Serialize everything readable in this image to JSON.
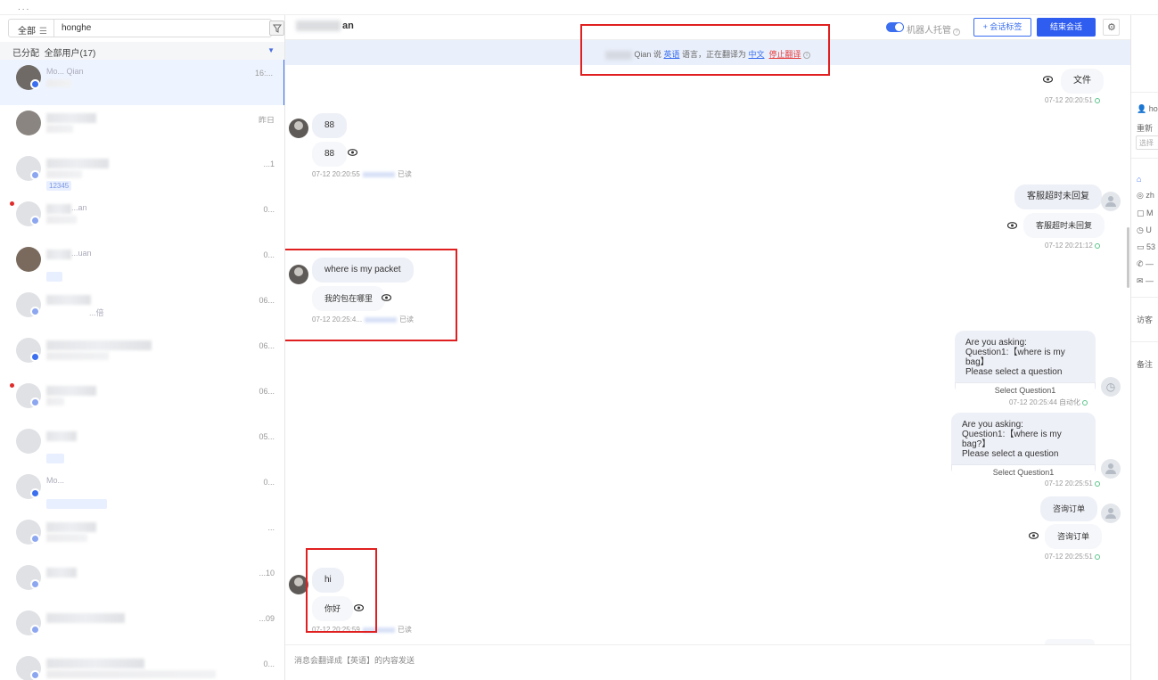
{
  "topbar": {
    "dots": "..."
  },
  "search": {
    "scope_label": "全部",
    "scope_icon": "☰",
    "query": "honghe"
  },
  "assigned": {
    "label": "已分配",
    "filter": "全部用户(17)"
  },
  "conversations": [
    {
      "name": "Mo... Qian",
      "time": "16:..."
    },
    {
      "name": "",
      "time": "昨日"
    },
    {
      "name": "",
      "time": "...1",
      "tag": "12345"
    },
    {
      "name": "...an",
      "time": "0..."
    },
    {
      "name": "...uan",
      "time": "0..."
    },
    {
      "name": "...倍",
      "time": "06..."
    },
    {
      "name": "",
      "time": "06..."
    },
    {
      "name": "",
      "time": "06..."
    },
    {
      "name": "",
      "time": "05..."
    },
    {
      "name": "Mo...",
      "time": "0..."
    },
    {
      "name": "",
      "time": "..."
    },
    {
      "name": "",
      "time": "...10"
    },
    {
      "name": "",
      "time": "...09"
    },
    {
      "name": "",
      "time": "0..."
    }
  ],
  "chat": {
    "name_suffix": "an",
    "robot_label": "机器人托管",
    "tag_button": "+ 会话标签",
    "end_button": "结束会话",
    "gear": "⚙",
    "notice": {
      "prefix": "Qian 说",
      "lang": "英语",
      "mid": "语言，正在翻译为",
      "target": "中文",
      "stop": "停止翻译",
      "info": "i"
    },
    "messages": {
      "file_label": "文件",
      "file_time": "07-12 20:20:51",
      "m88_a": "88",
      "m88_b": "88",
      "m88_time": "07-12 20:20:55",
      "m88_read": "已读",
      "agent_timeout_a": "客服超时未回复",
      "agent_timeout_b": "客服超时未回复",
      "agent_timeout_time": "07-12 20:21:12",
      "packet_a": "where is my packet",
      "packet_b": "我的包在哪里",
      "packet_time": "07-12 20:25:4...",
      "packet_read": "已读",
      "card1_text": "Are you asking:\nQuestion1:【where is my bag】\nPlease select a question",
      "card1_btn": "Select Question1",
      "card1_time": "07-12 20:25:44 自动化",
      "card2_text": "Are you asking:\nQuestion1:【where is my bag?】\nPlease select a question",
      "card2_btn": "Select Question1",
      "card2_time": "07-12 20:25:51",
      "order_a": "咨询订单",
      "order_b": "咨询订单",
      "order_time": "07-12 20:25:51",
      "hi_a": "hi",
      "hi_b": "你好",
      "hi_time": "07-12 20:25:59",
      "hi_read": "已读"
    },
    "composer_placeholder": "消息会翻译成【英语】的内容发送"
  },
  "right": {
    "user": "ho",
    "refresh": "重新",
    "input": "选择",
    "email": "zh",
    "m": "M",
    "u": "U",
    "num": "53",
    "phone": "—",
    "mail": "—",
    "visit": "访客",
    "remark": "备注"
  }
}
